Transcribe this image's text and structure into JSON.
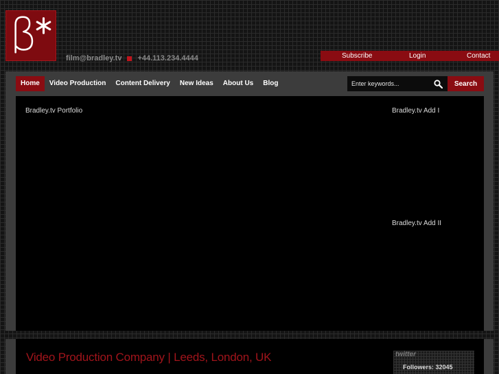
{
  "header": {
    "email": "film@bradley.tv",
    "phone": "+44.113.234.4444",
    "top_links": [
      "Subscribe",
      "Login",
      "Contact"
    ]
  },
  "nav": {
    "items": [
      "Home",
      "Video Production",
      "Content Delivery",
      "New Ideas",
      "About Us",
      "Blog"
    ],
    "active": "Home"
  },
  "search": {
    "placeholder": "Enter keywords...",
    "button_label": "Search",
    "icon": "search-icon"
  },
  "main": {
    "portfolio_label": "Bradley.tv Portfolio",
    "ad1_label": "Bradley.tv Add I",
    "ad2_label": "Bradley.tv Add II"
  },
  "lower": {
    "headline": "Video Production Company | Leeds, London, UK",
    "twitter_logo": "twitter",
    "followers": "Followers: 32045"
  },
  "colors": {
    "brand_red": "#8a0c12",
    "headline_red": "#a1141b",
    "panel_grey": "#3c3c3c"
  }
}
